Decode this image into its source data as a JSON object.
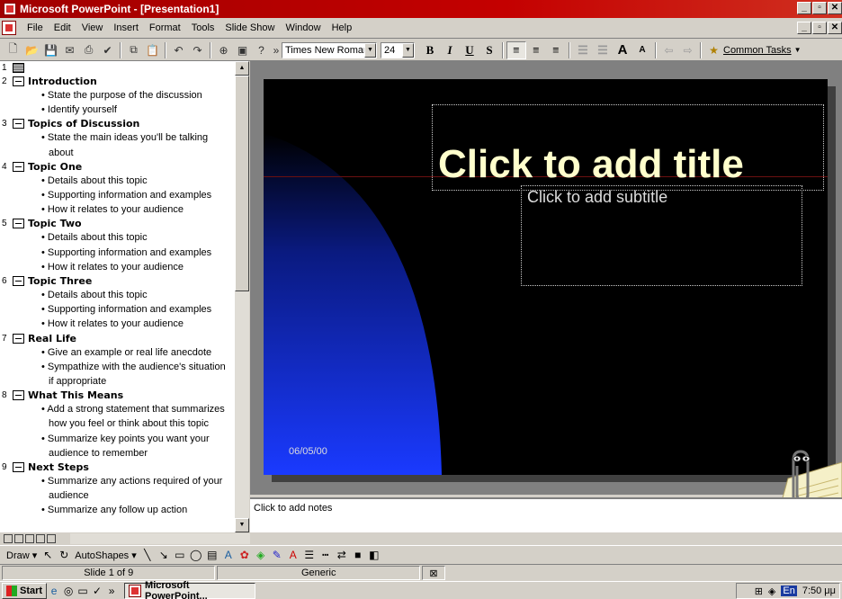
{
  "window": {
    "title": "Microsoft PowerPoint - [Presentation1]"
  },
  "menu": [
    "File",
    "Edit",
    "View",
    "Insert",
    "Format",
    "Tools",
    "Slide Show",
    "Window",
    "Help"
  ],
  "toolbar": {
    "font_name": "Times New Roman",
    "font_size": "24",
    "bold": "B",
    "italic": "I",
    "underline": "U",
    "shadow": "S",
    "common_tasks": "Common Tasks"
  },
  "outline": {
    "first_slide_num": "1",
    "slides": [
      {
        "num": "2",
        "title": "Introduction",
        "bullets": [
          "State the purpose of the discussion",
          "Identify yourself"
        ]
      },
      {
        "num": "3",
        "title": "Topics of Discussion",
        "bullets": [
          "State the main ideas you'll be talking about"
        ]
      },
      {
        "num": "4",
        "title": "Topic One",
        "bullets": [
          "Details about this topic",
          "Supporting information and examples",
          "How it relates to your audience"
        ]
      },
      {
        "num": "5",
        "title": "Topic Two",
        "bullets": [
          "Details about this topic",
          "Supporting information and examples",
          "How it relates to your audience"
        ]
      },
      {
        "num": "6",
        "title": "Topic Three",
        "bullets": [
          "Details about this topic",
          "Supporting information and examples",
          "How it relates to your audience"
        ]
      },
      {
        "num": "7",
        "title": "Real Life",
        "bullets": [
          "Give an example or real life anecdote",
          "Sympathize with the audience's situation if appropriate"
        ]
      },
      {
        "num": "8",
        "title": "What This Means",
        "bullets": [
          "Add a strong statement that summarizes how you feel or think about this topic",
          "Summarize key points you want your audience to remember"
        ]
      },
      {
        "num": "9",
        "title": "Next Steps",
        "bullets": [
          "Summarize any actions required of your audience",
          "Summarize any follow up action"
        ]
      }
    ]
  },
  "slide": {
    "title_placeholder": "Click to add title",
    "subtitle_placeholder": "Click to add subtitle",
    "date": "06/05/00"
  },
  "notes_placeholder": "Click to add notes",
  "drawbar": {
    "draw": "Draw",
    "autoshapes": "AutoShapes"
  },
  "status": {
    "slide": "Slide 1 of 9",
    "design": "Generic"
  },
  "taskbar": {
    "start": "Start",
    "task": "Microsoft PowerPoint...",
    "clock": "7:50 μμ",
    "lang": "En"
  },
  "colors": {
    "title_text": "#ffffcc",
    "titlebar": "#c40000",
    "slide_bg": "#000000",
    "accent_blue": "#1a3aff"
  }
}
